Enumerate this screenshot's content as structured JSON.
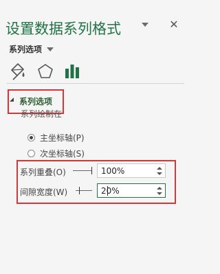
{
  "pane": {
    "title": "设置数据系列格式",
    "close_glyph": "✕"
  },
  "options_dropdown": {
    "label": "系列选项"
  },
  "tabs": [
    {
      "name": "fill-line",
      "icon": "paint-bucket-icon"
    },
    {
      "name": "effects",
      "icon": "pentagon-icon"
    },
    {
      "name": "series-options",
      "icon": "bar-chart-icon",
      "selected": true
    }
  ],
  "section": {
    "title": "系列选项",
    "plot_on_label": "系列绘制在"
  },
  "axis_options": [
    {
      "label": "主坐标轴(P)",
      "checked": true
    },
    {
      "label": "次坐标轴(S)",
      "checked": false
    }
  ],
  "fields": {
    "overlap": {
      "label": "系列重叠(O)",
      "value": "100%"
    },
    "gap_width": {
      "label": "间隙宽度(W)",
      "value": "20%"
    }
  },
  "colors": {
    "accent": "#217346",
    "highlight": "#e03232"
  }
}
